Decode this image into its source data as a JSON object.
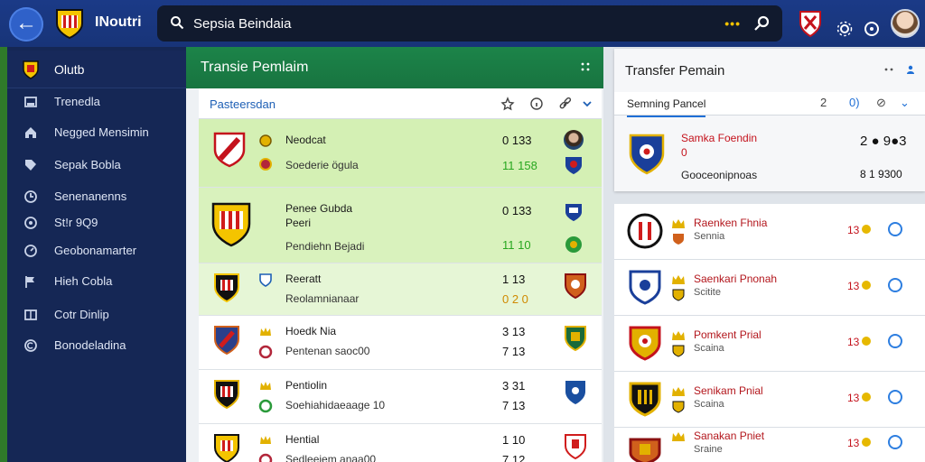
{
  "app": {
    "title": "INoutri"
  },
  "search": {
    "value": "Sepsia Beindaia",
    "dots": "•••"
  },
  "sidebar": {
    "header": "Olutb",
    "items": [
      {
        "label": "Trenedla",
        "icon": "card-icon"
      },
      {
        "label": "Negged Mensimin",
        "icon": "home-icon"
      },
      {
        "label": "Sepak Bobla",
        "icon": "tag-icon"
      },
      {
        "label": "Senenanenns",
        "icon": "clock-icon"
      },
      {
        "label": "St!r 9Q9",
        "icon": "target-icon"
      },
      {
        "label": "Geobonamarter",
        "icon": "dial-icon"
      },
      {
        "label": "Hieh Cobla",
        "icon": "flag-icon"
      },
      {
        "label": "Cotr Dinlip",
        "icon": "book-icon"
      },
      {
        "label": "Bonodeladina",
        "icon": "circle-c-icon"
      }
    ]
  },
  "center": {
    "title": "Transie Pemlaim",
    "filter_label": "Pasteersdan",
    "rows": [
      {
        "t1": "Neodcat",
        "t2": "Soederie ögula",
        "s1": "0  133",
        "s2": "11  158",
        "highlight": "green"
      },
      {
        "t1": "Penee Gubda",
        "t1b": "Peeri",
        "t2": "Pendiehn Bejadi",
        "s1": "0  133",
        "s2": "11  10",
        "highlight": "green"
      },
      {
        "t1": "Reeratt",
        "t2": "Reolamnianaar",
        "s1": "1   13",
        "s2": "0   2 0",
        "highlight": "lightgreen"
      },
      {
        "t1": "Hoedk Nia",
        "t2": "Pentenan saoc00",
        "s1": "3   13",
        "s2": "7   13",
        "highlight": "none"
      },
      {
        "t1": "Pentiolin",
        "t2": "Soehiahidaeaage 10",
        "s1": "3   31",
        "s2": "7   13",
        "highlight": "none"
      },
      {
        "t1": "Hential",
        "t2": "Sedleeiem anaa00",
        "s1": "1   10",
        "s2": "7   12",
        "highlight": "none"
      }
    ]
  },
  "right": {
    "title": "Transfer Pemain",
    "filter_label": "Semning Pancel",
    "filter_icons": [
      "2",
      "0)",
      "⊘",
      "⌄"
    ],
    "featured": {
      "n1": "Samka Foendin",
      "n2": "0",
      "n3": "Gooceonipnoas",
      "v1": "2 ●  9●3",
      "v2": "8   1 9300"
    },
    "items": [
      {
        "n1": "Raenken Fhnia",
        "n2": "Sennia",
        "v": "13"
      },
      {
        "n1": "Saenkari Pnonah",
        "n2": "Scitite",
        "v": "13"
      },
      {
        "n1": "Pomkent Prial",
        "n2": "Scaina",
        "v": "13"
      },
      {
        "n1": "Senikam Pnial",
        "n2": "Scaina",
        "v": "13"
      },
      {
        "n1": "Sanakan Pniet",
        "n2": "Sraine",
        "v": "13"
      }
    ]
  },
  "colors": {
    "topbar": "#1b3a87",
    "sidebar": "#152755",
    "panel_header": "#1c8449",
    "accent_red": "#c4121c",
    "accent_blue": "#1f6fd6",
    "highlight_green": "#d4f0b4"
  }
}
